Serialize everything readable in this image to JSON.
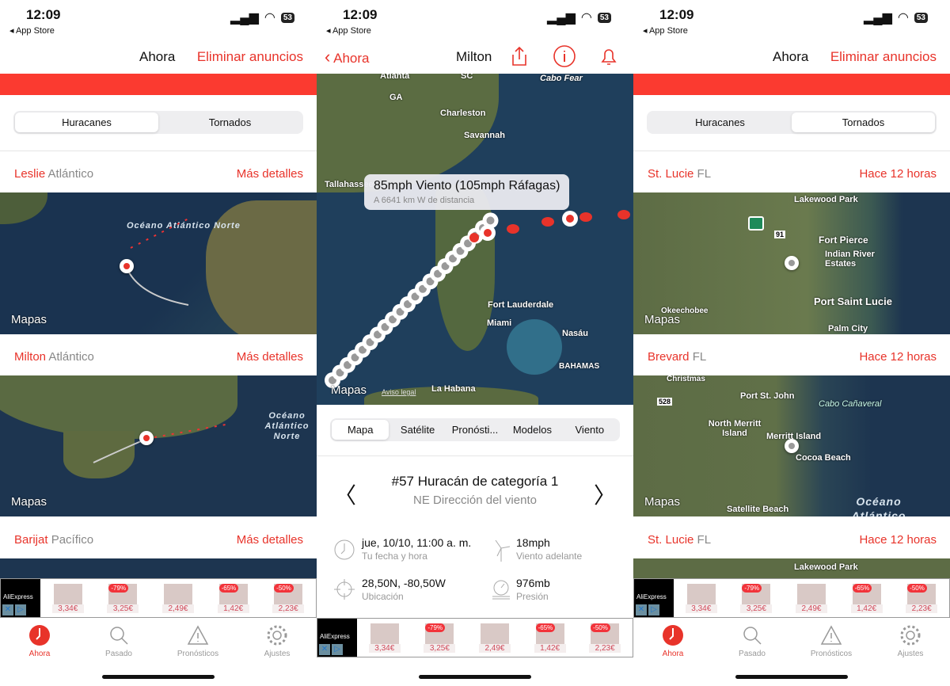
{
  "status": {
    "time": "12:09",
    "back": "◂ App Store",
    "battery": "53"
  },
  "left": {
    "nav_title": "Ahora",
    "remove_ads": "Eliminar anuncios",
    "segments": [
      "Huracanes",
      "Tornados"
    ],
    "selected": "Huracanes",
    "rows": [
      {
        "name": "Leslie",
        "basin": "Atlántico",
        "action": "Más detalles",
        "ocean": "Océano Atlántico Norte"
      },
      {
        "name": "Milton",
        "basin": "Atlántico",
        "action": "Más detalles",
        "ocean": "Océano Atlántico Norte"
      },
      {
        "name": "Barijat",
        "basin": "Pacífico",
        "action": "Más detalles"
      }
    ]
  },
  "map_logo": "Mapas",
  "center": {
    "back": "Ahora",
    "title": "Milton",
    "tooltip": {
      "title": "85mph Viento (105mph Ráfagas)",
      "subtitle": "A 6641 km W de distancia"
    },
    "map_labels": [
      "Atlanta",
      "SC",
      "GA",
      "Charleston",
      "Savannah",
      "Tallahassee",
      "Fort Lauderdale",
      "Miami",
      "Nasáu",
      "BAHAMAS",
      "La Habana",
      "Cabo Fear"
    ],
    "legal": "Aviso legal",
    "segments": [
      "Mapa",
      "Satélite",
      "Pronósti...",
      "Modelos",
      "Viento"
    ],
    "selected": "Mapa",
    "info_title": "#57 Huracán de categoría 1",
    "info_subtitle": "NE Dirección del viento",
    "details": [
      {
        "icon": "clock-icon",
        "value": "jue, 10/10, 11:00 a. m.",
        "label": "Tu fecha y hora"
      },
      {
        "icon": "wind-turbine-icon",
        "value": "18mph",
        "label": "Viento adelante"
      },
      {
        "icon": "crosshair-icon",
        "value": "28,50N, -80,50W",
        "label": "Ubicación"
      },
      {
        "icon": "barometer-icon",
        "value": "976mb",
        "label": "Presión"
      }
    ]
  },
  "right": {
    "nav_title": "Ahora",
    "remove_ads": "Eliminar anuncios",
    "segments": [
      "Huracanes",
      "Tornados"
    ],
    "selected": "Tornados",
    "rows": [
      {
        "name": "St. Lucie",
        "state": "FL",
        "time": "Hace 12 horas",
        "labels": [
          "Lakewood Park",
          "Fort Pierce",
          "Indian River Estates",
          "Port Saint Lucie",
          "Okeechobee",
          "Palm City",
          "91"
        ]
      },
      {
        "name": "Brevard",
        "state": "FL",
        "time": "Hace 12 horas",
        "labels": [
          "Christmas",
          "Port St. John",
          "Cabo Cañaveral",
          "North Merritt Island",
          "Merritt Island",
          "Cocoa Beach",
          "Satellite Beach",
          "528",
          "Océano Atlántico"
        ]
      },
      {
        "name": "St. Lucie",
        "state": "FL",
        "time": "Hace 12 horas",
        "labels": [
          "Lakewood Park"
        ]
      }
    ]
  },
  "ad": {
    "brand": "AliExpress",
    "items": [
      {
        "price": "3,34€",
        "discount": ""
      },
      {
        "price": "3,25€",
        "discount": "-79%"
      },
      {
        "price": "2,49€",
        "discount": ""
      },
      {
        "price": "1,42€",
        "discount": "-65%"
      },
      {
        "price": "2,23€",
        "discount": "-50%"
      }
    ]
  },
  "tabs": [
    "Ahora",
    "Pasado",
    "Pronósticos",
    "Ajustes"
  ],
  "colors": {
    "accent": "#e8332a",
    "ocean": "#1d3550",
    "land": "#5c6e3e"
  }
}
